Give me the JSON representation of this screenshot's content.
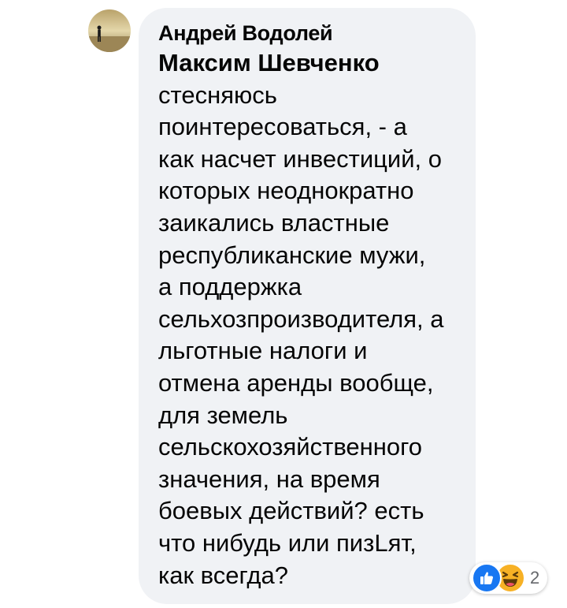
{
  "comment": {
    "author": "Андрей Водолей",
    "mention": "Максим Шевченко",
    "text": "стесняюсь\nпоинтересоваться, - а\nкак насчет инвестиций, о\nкоторых неоднократно\nзаикались властные\nреспубликанские мужи,\nа поддержка\nсельхозпроизводителя, а\nльготные налоги и\nотмена аренды вообще,\nдля земель\nсельскохозяйственного\nзначения, на время\nбоевых действий? есть\nчто нибудь или пизLят,\nкак всегда?",
    "reactions": {
      "icons": [
        "like-icon",
        "haha-icon"
      ],
      "count": "2"
    }
  },
  "colors": {
    "bubble": "#f0f2f5",
    "like": "#1877f2",
    "haha": "#f7b125",
    "text": "#050505",
    "muted": "#65676b"
  }
}
